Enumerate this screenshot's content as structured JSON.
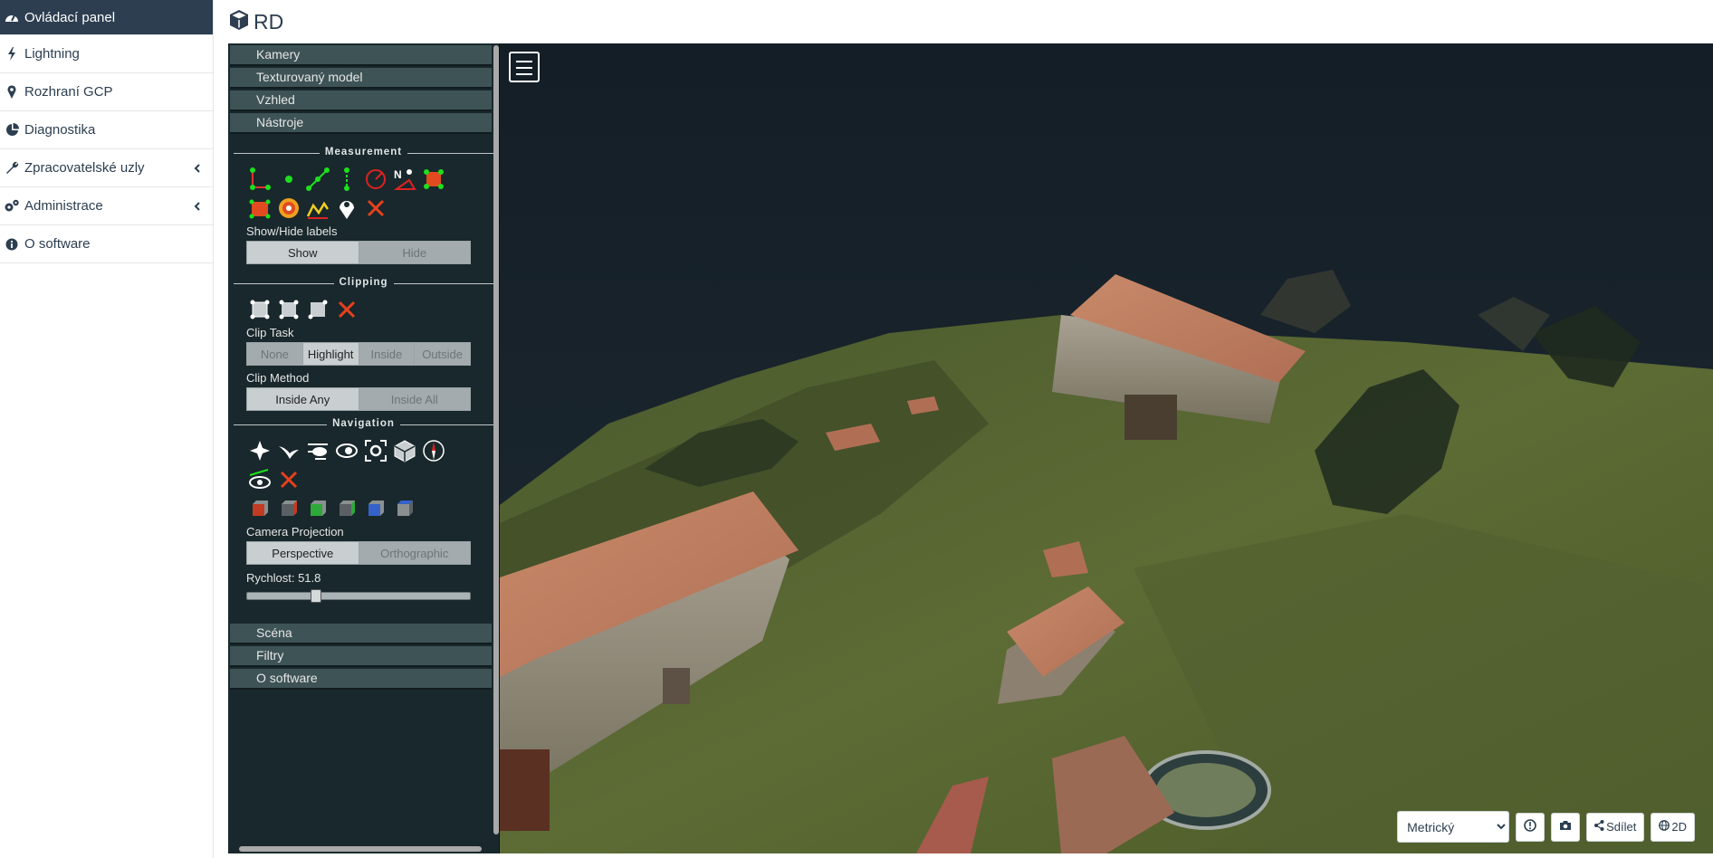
{
  "sidebar": {
    "items": [
      {
        "label": "Ovládací panel",
        "icon": "dashboard-icon",
        "active": true
      },
      {
        "label": "Lightning",
        "icon": "bolt-icon"
      },
      {
        "label": "Rozhraní GCP",
        "icon": "map-marker-icon"
      },
      {
        "label": "Diagnostika",
        "icon": "pie-chart-icon"
      },
      {
        "label": "Zpracovatelské uzly",
        "icon": "wrench-icon",
        "has_submenu": true
      },
      {
        "label": "Administrace",
        "icon": "gears-icon",
        "has_submenu": true
      },
      {
        "label": "O software",
        "icon": "info-icon"
      }
    ]
  },
  "header": {
    "title": "RD",
    "icon": "cube-icon"
  },
  "panel": {
    "accordion_top": [
      "Kamery",
      "Texturovaný model",
      "Vzhled",
      "Nástroje"
    ],
    "measurement": {
      "title": "Measurement",
      "show_hide_label": "Show/Hide labels",
      "show": "Show",
      "hide": "Hide"
    },
    "clipping": {
      "title": "Clipping",
      "clip_task_label": "Clip Task",
      "clip_task_options": [
        "None",
        "Highlight",
        "Inside",
        "Outside"
      ],
      "clip_task_selected": "Highlight",
      "clip_method_label": "Clip Method",
      "clip_method_options": [
        "Inside Any",
        "Inside All"
      ],
      "clip_method_selected": "Inside Any"
    },
    "navigation": {
      "title": "Navigation",
      "camera_projection_label": "Camera Projection",
      "perspective": "Perspective",
      "orthographic": "Orthographic",
      "speed_label": "Rychlost: 51.8",
      "speed_fraction": 0.3
    },
    "accordion_bottom": [
      "Scéna",
      "Filtry",
      "O software"
    ]
  },
  "controls": {
    "units_selected": "Metrický",
    "share_label": "Sdílet",
    "view_mode_label": "2D"
  },
  "colors": {
    "sidebar_active": "#2c3e50",
    "panel_bg": "#19282c",
    "accordion_header": "#3e5356"
  }
}
